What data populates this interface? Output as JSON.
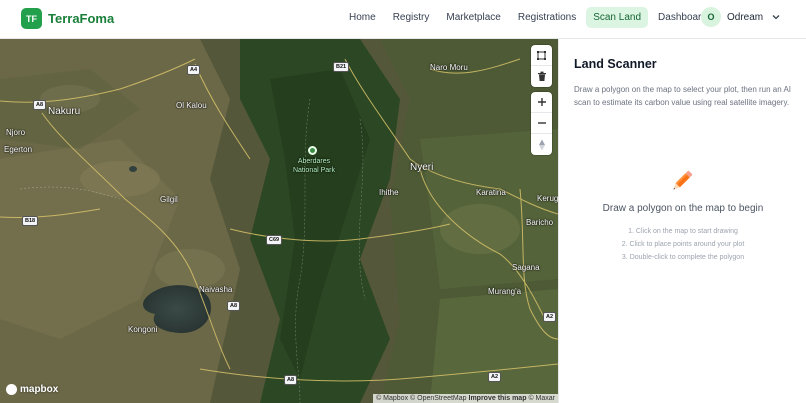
{
  "brand": {
    "badge": "TF",
    "name": "TerraFoma",
    "accent": "#22a04b"
  },
  "nav": {
    "items": [
      {
        "label": "Home"
      },
      {
        "label": "Registry"
      },
      {
        "label": "Marketplace"
      },
      {
        "label": "Registrations"
      },
      {
        "label": "Scan Land",
        "active": true
      },
      {
        "label": "Dashboard"
      }
    ]
  },
  "user": {
    "initial": "O",
    "name": "Odream",
    "menu_icon": "chevron-down-icon"
  },
  "map": {
    "places": {
      "nakuru": "Nakuru",
      "ol_kalou": "Ol Kalou",
      "njoro": "Njoro",
      "egerton": "Egerton",
      "gilgil": "Gilgil",
      "naivasha": "Naivasha",
      "kongoni": "Kongoni",
      "aberdares": "Aberdares National Park",
      "nyeri": "Nyeri",
      "ihithe": "Ihithe",
      "karatina": "Karatina",
      "naro_moru": "Naro Moru",
      "kerug": "Kerug",
      "baricho": "Baricho",
      "sagana": "Sagana",
      "muranga": "Murang'a"
    },
    "roads": {
      "a4": "A4",
      "a8_top": "A8",
      "b21": "B21",
      "b18": "B18",
      "c69": "C69",
      "a8_mid": "A8",
      "a8_bottom": "A8",
      "a2_mid": "A2",
      "a2_bottom": "A2"
    },
    "controls": [
      "polygon-draw-icon",
      "trash-icon",
      "zoom-in-icon",
      "zoom-out-icon",
      "compass-icon"
    ],
    "logo": "mapbox",
    "attribution": {
      "mapbox": "© Mapbox",
      "osm": "© OpenStreetMap",
      "improve": "Improve this map",
      "maxar": "© Maxar"
    }
  },
  "panel": {
    "title": "Land Scanner",
    "description": "Draw a polygon on the map to select your plot, then run an AI scan to estimate its carbon value using real satellite imagery.",
    "empty_icon": "pencil-icon",
    "empty_title": "Draw a polygon on the map to begin",
    "steps": [
      "1. Click on the map to start drawing",
      "2. Click to place points around your plot",
      "3. Double-click to complete the polygon"
    ]
  }
}
